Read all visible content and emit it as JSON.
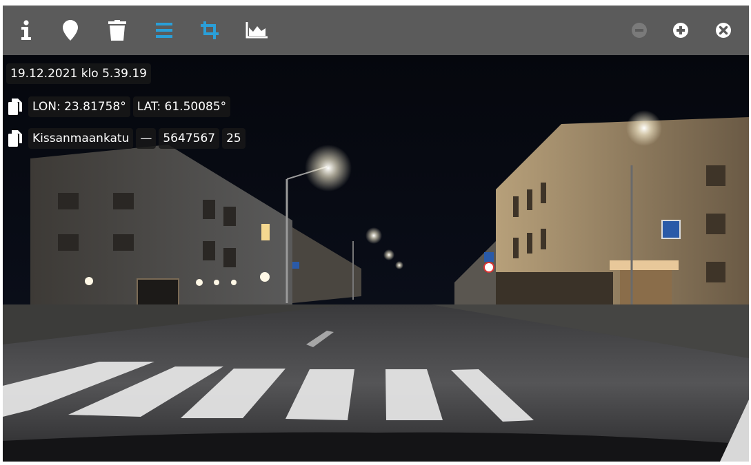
{
  "toolbar": {
    "left_icons": [
      "info-icon",
      "map-marker-icon",
      "trash-icon",
      "menu-lines-icon",
      "crop-icon",
      "chart-area-icon"
    ],
    "right_icons": [
      "zoom-out-icon",
      "zoom-in-icon",
      "close-icon"
    ],
    "colors": {
      "bar": "#5b5b5b",
      "icon": "#ffffff",
      "accent": "#2a9fd8",
      "disabled": "#7a7a7a"
    }
  },
  "overlay": {
    "timestamp": "19.12.2021 klo 5.39.19",
    "lon": "LON: 23.81758°",
    "lat": "LAT: 61.50085°",
    "street": "Kissanmaankatu",
    "separator": "—",
    "id": "5647567",
    "number": "25"
  },
  "icons": {
    "copy_coords": "copy-icon",
    "copy_address": "copy-icon"
  }
}
